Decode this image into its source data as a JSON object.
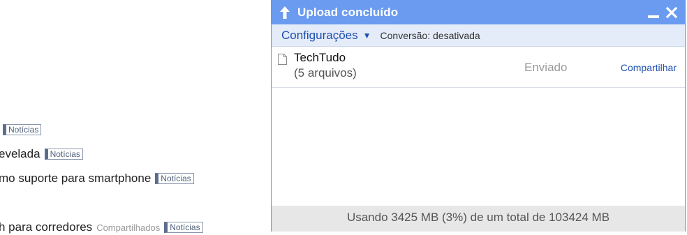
{
  "feed": {
    "rows": [
      {
        "title": "",
        "tag": "Notícias"
      },
      {
        "title": "evelada",
        "tag": "Notícias"
      },
      {
        "title": "mo suporte para smartphone",
        "tag": "Notícias"
      },
      {
        "title": "h para corredores",
        "shared_label": "Compartilhados",
        "tag": "Notícias"
      }
    ]
  },
  "upload_panel": {
    "title": "Upload concluído",
    "header_color": "#6a9bf0",
    "icons": {
      "header": "upload-arrow-icon",
      "minimize": "minimize-icon",
      "close": "close-icon",
      "file": "document-icon"
    },
    "toolbar": {
      "settings_label": "Configurações",
      "settings_arrow": "▼",
      "conversion_status": "Conversão: desativada"
    },
    "files": [
      {
        "name": "TechTudo",
        "count": "(5 arquivos)",
        "status": "Enviado",
        "action": "Compartilhar"
      }
    ],
    "footer_usage": "Usando 3425 MB (3%) de um total de 103424 MB"
  }
}
